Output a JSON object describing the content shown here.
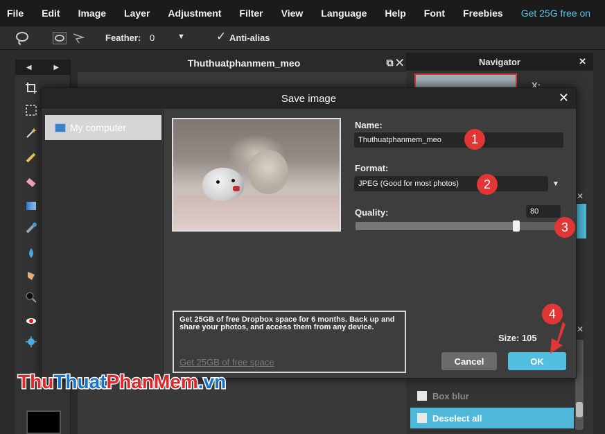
{
  "menu": {
    "items": [
      "File",
      "Edit",
      "Image",
      "Layer",
      "Adjustment",
      "Filter",
      "View",
      "Language",
      "Help",
      "Font",
      "Freebies"
    ],
    "promo": "Get 25G free on"
  },
  "options_bar": {
    "feather_label": "Feather:",
    "feather_value": "0",
    "antialias_label": "Anti-alias",
    "antialias_checked": true
  },
  "document": {
    "title": "Thuthuatphanmem_meo"
  },
  "navigator": {
    "title": "Navigator",
    "x_label": "X:"
  },
  "history": {
    "items": [
      {
        "label": "Box blur",
        "active": false
      },
      {
        "label": "Deselect all",
        "active": true
      }
    ]
  },
  "dialog": {
    "title": "Save image",
    "location": "My computer",
    "name_label": "Name:",
    "name_value": "Thuthuatphanmem_meo",
    "format_label": "Format:",
    "format_value": "JPEG (Good for most photos)",
    "quality_label": "Quality:",
    "quality_value": "80",
    "quality_fraction": 0.8,
    "promo_text": "Get 25GB of free Dropbox space for 6 months. Back up and share your photos, and access them from any device.",
    "promo_link": "Get 25GB of free space",
    "size_label": "Size: 105",
    "cancel_label": "Cancel",
    "ok_label": "OK"
  },
  "annotations": {
    "step1": "1",
    "step2": "2",
    "step3": "3",
    "step4": "4"
  },
  "colors": {
    "accent": "#52bfe0",
    "badge": "#e03636",
    "promo_menu": "#59c4e6"
  },
  "watermark": "ThuThuatPhanMem.vn"
}
